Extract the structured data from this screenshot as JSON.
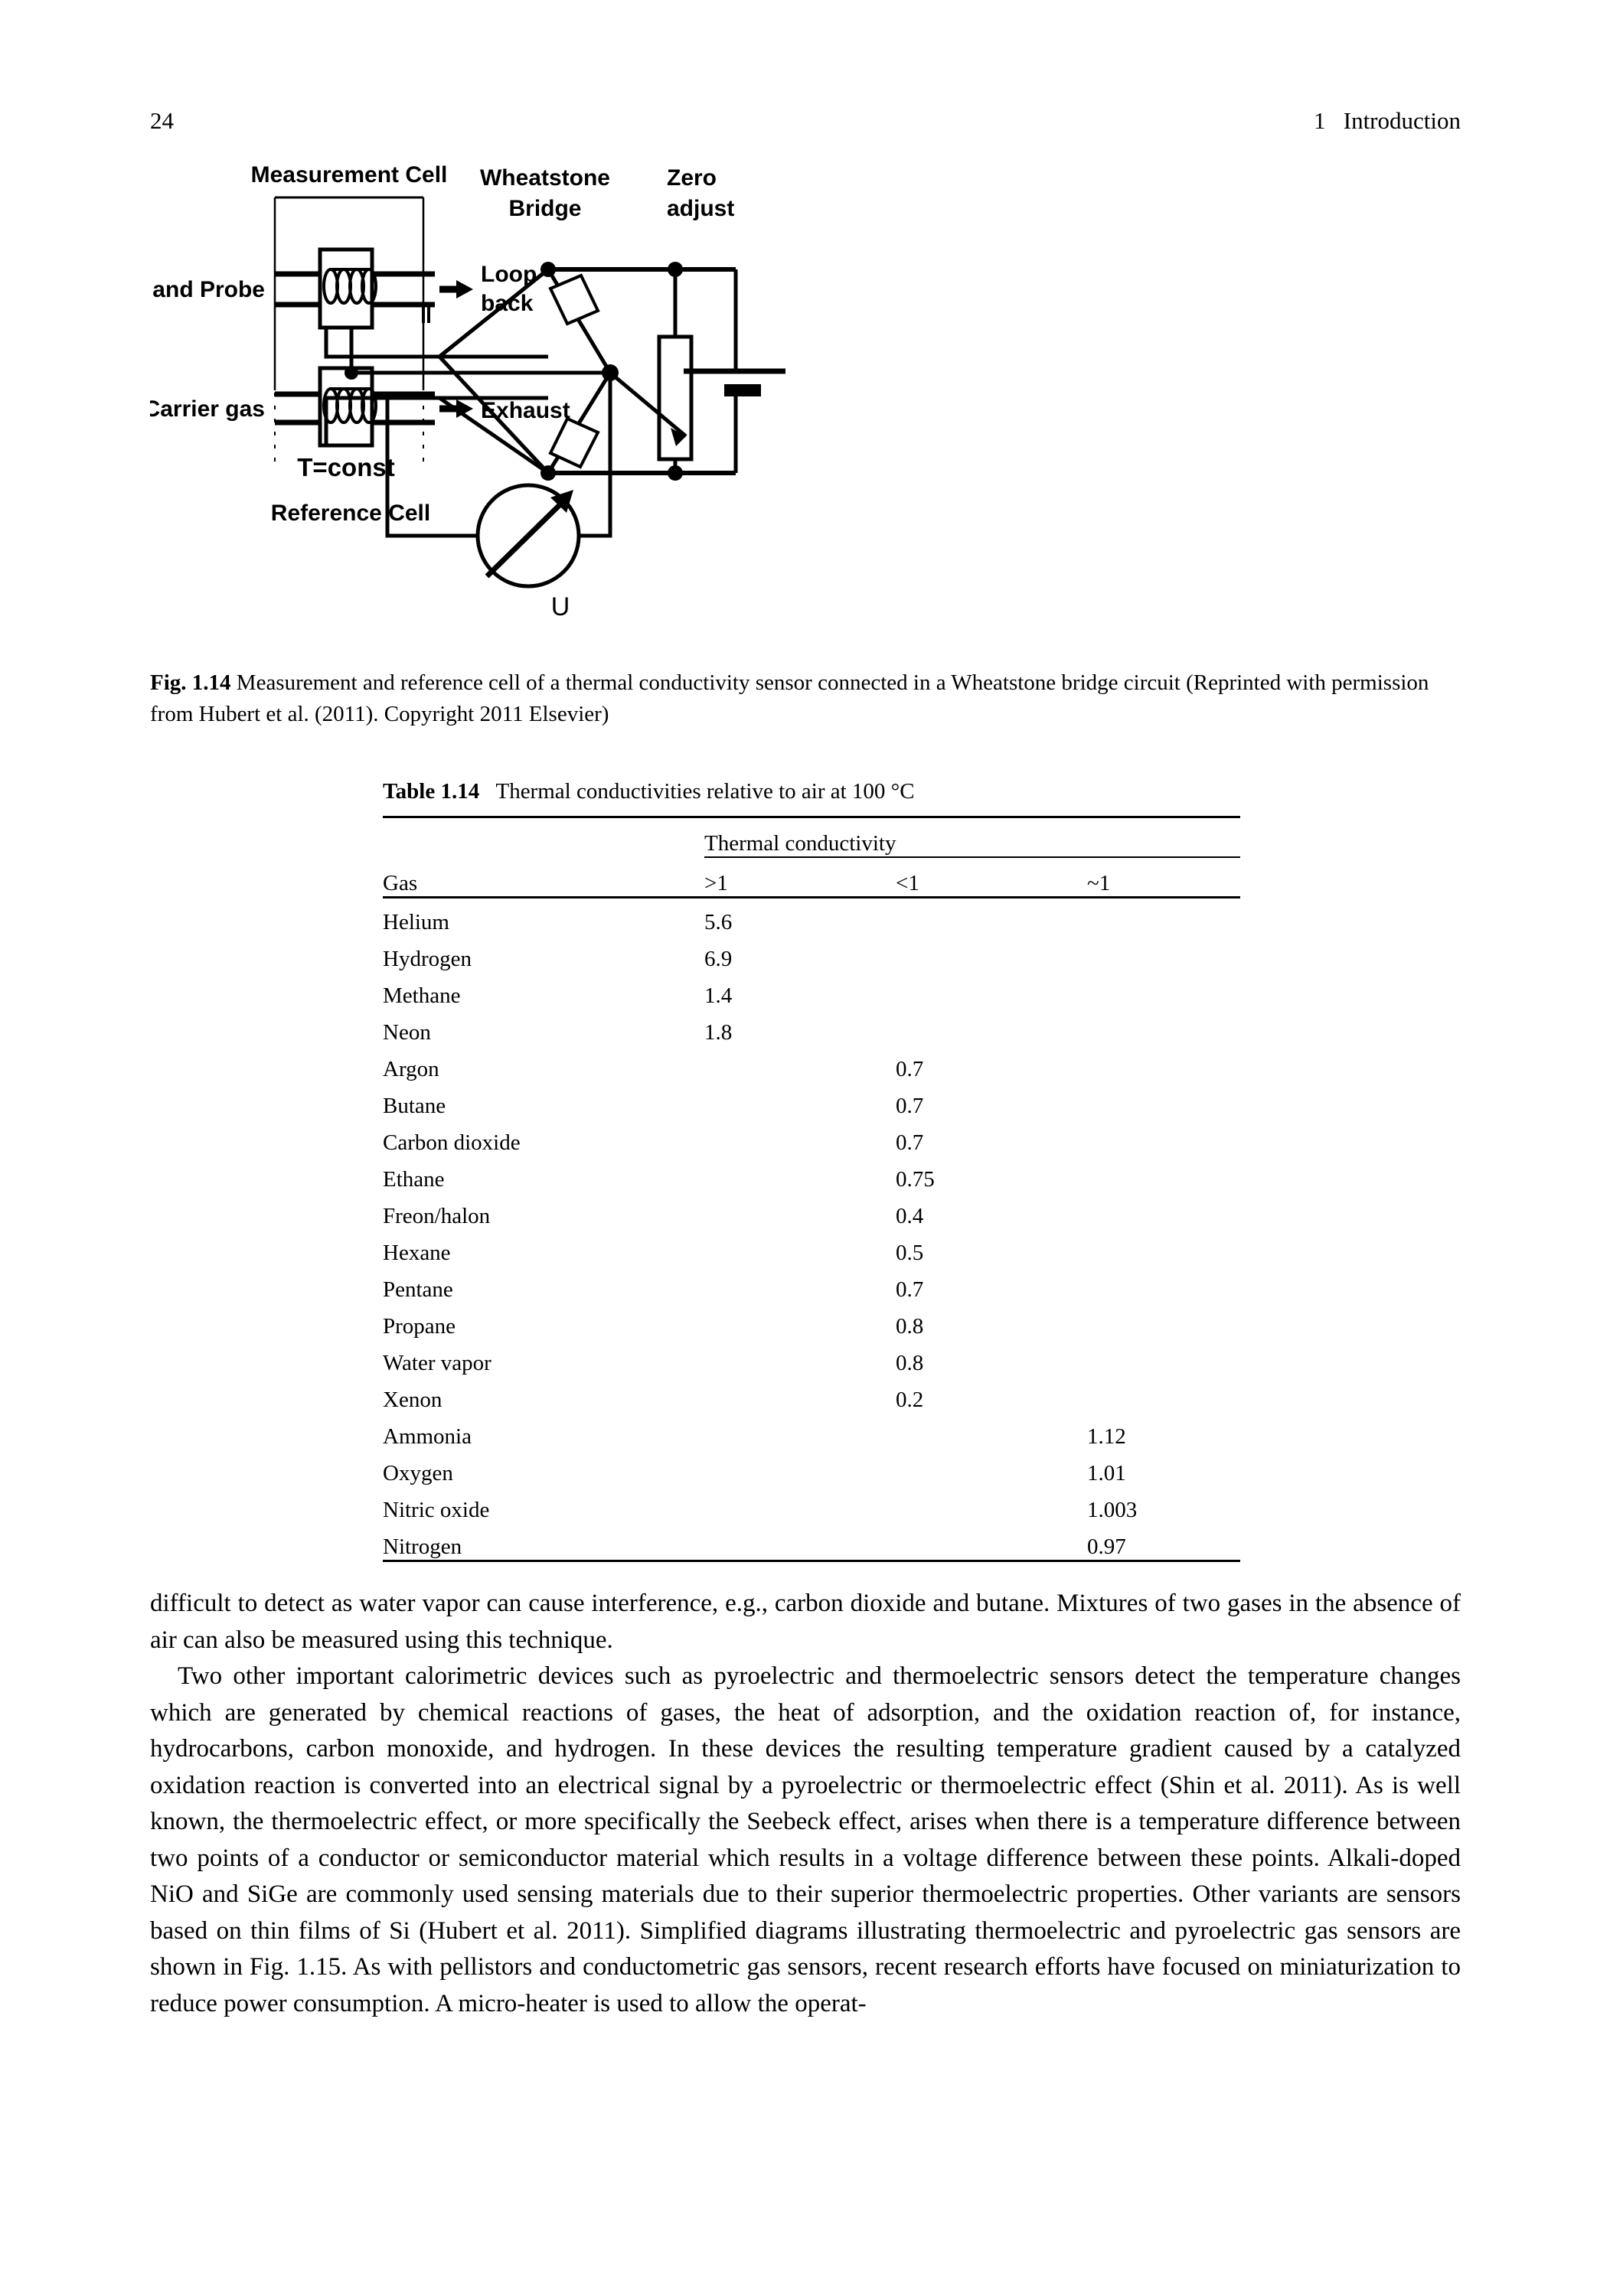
{
  "page": {
    "folio": "24",
    "chapter_title": "1   Introduction"
  },
  "figure": {
    "labels": {
      "measurement_cell": "Measurement Cell",
      "carrier_gas_and_probe": "Carrier gas and Probe",
      "carrier_gas": "Carrier gas",
      "loop_back_line1": "Loop",
      "loop_back_line2": "back",
      "exhaust": "Exhaust",
      "t_const": "T=const",
      "reference_cell": "Reference Cell",
      "wheatstone_line1": "Wheatstone",
      "wheatstone_line2": "Bridge",
      "zero_adjust_line1": "Zero",
      "zero_adjust_line2": "adjust",
      "voltmeter": "U"
    },
    "caption_label": "Fig. 1.14",
    "caption_text": "  Measurement and reference cell of a thermal conductivity sensor connected in a Wheatstone bridge circuit (Reprinted with permission from Hubert et al. (2011). Copyright 2011 Elsevier)"
  },
  "table": {
    "label": "Table 1.14",
    "title": "   Thermal conductivities relative to air at 100 °C",
    "group_header": "Thermal conductivity",
    "columns": [
      "Gas",
      ">1",
      "<1",
      "~1"
    ],
    "rows": [
      {
        "gas": "Helium",
        "gt1": "5.6",
        "lt1": "",
        "ap1": ""
      },
      {
        "gas": "Hydrogen",
        "gt1": "6.9",
        "lt1": "",
        "ap1": ""
      },
      {
        "gas": "Methane",
        "gt1": "1.4",
        "lt1": "",
        "ap1": ""
      },
      {
        "gas": "Neon",
        "gt1": "1.8",
        "lt1": "",
        "ap1": ""
      },
      {
        "gas": "Argon",
        "gt1": "",
        "lt1": "0.7",
        "ap1": ""
      },
      {
        "gas": "Butane",
        "gt1": "",
        "lt1": "0.7",
        "ap1": ""
      },
      {
        "gas": "Carbon dioxide",
        "gt1": "",
        "lt1": "0.7",
        "ap1": ""
      },
      {
        "gas": "Ethane",
        "gt1": "",
        "lt1": "0.75",
        "ap1": ""
      },
      {
        "gas": "Freon/halon",
        "gt1": "",
        "lt1": "0.4",
        "ap1": ""
      },
      {
        "gas": "Hexane",
        "gt1": "",
        "lt1": "0.5",
        "ap1": ""
      },
      {
        "gas": "Pentane",
        "gt1": "",
        "lt1": "0.7",
        "ap1": ""
      },
      {
        "gas": "Propane",
        "gt1": "",
        "lt1": "0.8",
        "ap1": ""
      },
      {
        "gas": "Water vapor",
        "gt1": "",
        "lt1": "0.8",
        "ap1": ""
      },
      {
        "gas": "Xenon",
        "gt1": "",
        "lt1": "0.2",
        "ap1": ""
      },
      {
        "gas": "Ammonia",
        "gt1": "",
        "lt1": "",
        "ap1": "1.12"
      },
      {
        "gas": "Oxygen",
        "gt1": "",
        "lt1": "",
        "ap1": "1.01"
      },
      {
        "gas": "Nitric oxide",
        "gt1": "",
        "lt1": "",
        "ap1": "1.003"
      },
      {
        "gas": "Nitrogen",
        "gt1": "",
        "lt1": "",
        "ap1": "0.97"
      }
    ]
  },
  "body": {
    "paragraph_1": "difficult to detect as water vapor can cause interference, e.g., carbon dioxide and butane. Mixtures of two gases in the absence of air can also be measured using this technique.",
    "paragraph_2": "Two other important calorimetric devices such as pyroelectric and thermoelectric sensors detect the temperature changes which are generated by chemical reactions of gases, the heat of adsorption, and the oxidation reaction of, for instance, hydrocarbons, carbon monoxide, and hydrogen. In these devices the resulting temperature gradient caused by a catalyzed oxidation reaction is converted into an electrical signal by a pyroelectric or thermoelectric effect (Shin et al. 2011). As is well known, the thermoelectric effect, or more specifically the Seebeck effect, arises when there is a temperature difference between two points of a conductor or semiconductor material which results in a voltage difference between these points. Alkali-doped NiO and SiGe are commonly used sensing materials due to their superior thermoelectric properties. Other variants are sensors based on thin films of Si (Hubert et al. 2011). Simplified diagrams illustrating thermoelectric and pyroelectric gas sensors are shown in Fig. 1.15. As with pellistors and conductometric gas sensors, recent research efforts have focused on miniaturization to reduce power consumption. A micro-heater is used to allow the operat-"
  }
}
